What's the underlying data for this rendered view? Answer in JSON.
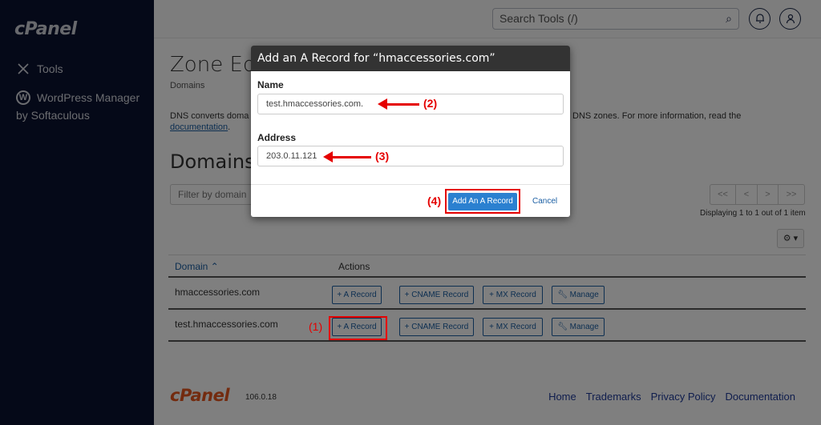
{
  "sidebar": {
    "logo": "cPanel",
    "items": [
      {
        "label": "Tools",
        "icon": "tools-icon"
      },
      {
        "label": "WordPress Manager",
        "label2": "by Softaculous",
        "icon": "wordpress-icon"
      }
    ]
  },
  "topbar": {
    "search_placeholder": "Search Tools (/)",
    "search_icon": "⌕",
    "bell_icon": "🔔︎",
    "user_icon": "👤︎"
  },
  "page": {
    "title": "Zone Editor",
    "breadcrumb": "Domains",
    "description_left": "DNS converts doma",
    "description_right": "DNS zones. For more information, read the",
    "documentation_link": "documentation",
    "domains_heading": "Domains",
    "filter_placeholder": "Filter by domain"
  },
  "pagination": {
    "first": "<<",
    "prev": "<",
    "next": ">",
    "last": ">>",
    "displaying": "Displaying 1 to 1 out of 1 item",
    "settings_icon": "⚙ ▾"
  },
  "table": {
    "headers": {
      "domain": "Domain ⌃",
      "actions": "Actions"
    },
    "action_labels": {
      "a": "+ A Record",
      "cname": "+ CNAME Record",
      "mx": "+ MX Record",
      "manage": "🔧︎ Manage"
    },
    "rows": [
      {
        "domain": "hmaccessories.com"
      },
      {
        "domain": "test.hmaccessories.com"
      }
    ]
  },
  "modal": {
    "title": "Add an A Record for “hmaccessories.com”",
    "name_label": "Name",
    "name_value": "test.hmaccessories.com.",
    "address_label": "Address",
    "address_value": "203.0.11.121",
    "add_button": "Add An A Record",
    "cancel_button": "Cancel"
  },
  "annotations": {
    "step1": "(1)",
    "step2": "(2)",
    "step3": "(3)",
    "step4": "(4)",
    "color": "#e50000"
  },
  "footer": {
    "logo": "cPanel",
    "version": "106.0.18",
    "links": [
      "Home",
      "Trademarks",
      "Privacy Policy",
      "Documentation"
    ]
  }
}
